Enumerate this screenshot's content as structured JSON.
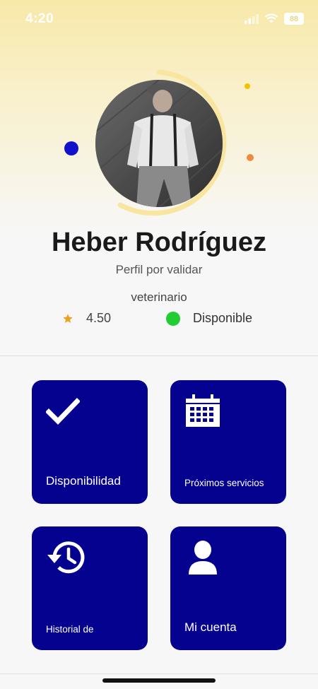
{
  "status_bar": {
    "time": "4:20",
    "battery": "88"
  },
  "profile": {
    "name": "Heber Rodríguez",
    "status": "Perfil por validar",
    "role": "veterinario",
    "rating": "4.50",
    "availability": "Disponible"
  },
  "colors": {
    "tile": "#04028f",
    "available": "#22cc33",
    "star": "#f0a020",
    "accent_blue": "#1111cc",
    "accent_yellow": "#f2c200",
    "accent_orange": "#f08a3c"
  },
  "tiles": [
    {
      "label": "Disponibilidad",
      "icon": "checkmark-icon"
    },
    {
      "label": "Próximos servicios",
      "icon": "calendar-icon"
    },
    {
      "label": "Historial de",
      "icon": "history-icon"
    },
    {
      "label": "Mi cuenta",
      "icon": "user-icon"
    }
  ]
}
